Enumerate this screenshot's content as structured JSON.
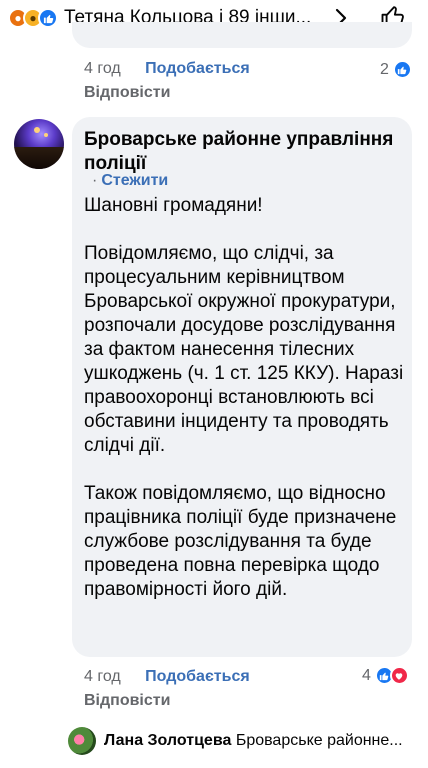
{
  "top": {
    "reactions": [
      "angry",
      "sad",
      "like"
    ],
    "names": "Тетяна Кольцова і 89 інши..."
  },
  "prev_comment": {
    "time": "4 год",
    "like_label": "Подобається",
    "reaction_count": "2",
    "reply_label": "Відповісти"
  },
  "comment": {
    "author": "Броварське районне управління поліції",
    "follow_label": "Стежити",
    "paragraphs": [
      "Шановні громадяни!",
      "Повідомляємо, що слідчі, за процесуальним керівництвом Броварської окружної прокуратури, розпочали досудове розслідування за фактом нанесення тілесних ушкоджень (ч. 1 ст. 125 ККУ). Наразі правоохоронці встановлюють всі обставини інциденту та проводять слідчі дії.",
      "Також повідомляємо, що відносно працівника поліції буде призначене службове розслідування та буде проведена повна перевірка щодо правомірності його дій."
    ],
    "time": "4 год",
    "like_label": "Подобається",
    "reaction_count": "4",
    "reply_label": "Відповісти"
  },
  "reply_preview": {
    "name": "Лана Золотцева",
    "text": "Броварське районне..."
  },
  "colors": {
    "accent": "#1877f2",
    "bubble": "#f0f2f5",
    "muted": "#65676b",
    "love": "#f02849"
  }
}
